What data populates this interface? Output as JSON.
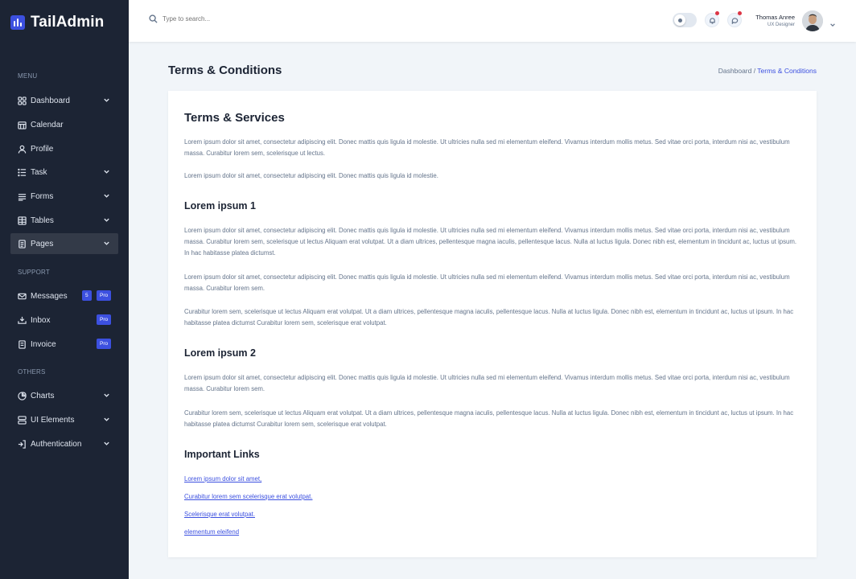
{
  "brand": {
    "name": "TailAdmin"
  },
  "sidebar": {
    "sections": {
      "menu": "MENU",
      "support": "SUPPORT",
      "others": "OTHERS"
    },
    "items": [
      {
        "label": "Dashboard",
        "icon": "grid-icon"
      },
      {
        "label": "Calendar",
        "icon": "calendar-icon"
      },
      {
        "label": "Profile",
        "icon": "user-icon"
      },
      {
        "label": "Task",
        "icon": "list-icon"
      },
      {
        "label": "Forms",
        "icon": "form-icon"
      },
      {
        "label": "Tables",
        "icon": "table-icon"
      },
      {
        "label": "Pages",
        "icon": "page-icon",
        "active": true
      },
      {
        "label": "Messages",
        "icon": "mail-icon",
        "count": "5",
        "badge": "Pro"
      },
      {
        "label": "Inbox",
        "icon": "inbox-icon",
        "badge": "Pro"
      },
      {
        "label": "Invoice",
        "icon": "invoice-icon",
        "badge": "Pro"
      },
      {
        "label": "Charts",
        "icon": "pie-chart-icon"
      },
      {
        "label": "UI Elements",
        "icon": "layers-icon"
      },
      {
        "label": "Authentication",
        "icon": "login-icon"
      }
    ]
  },
  "header": {
    "search_placeholder": "Type to search...",
    "user": {
      "name": "Thomas Anree",
      "role": "UX Designer"
    }
  },
  "page": {
    "title": "Terms & Conditions",
    "breadcrumb": {
      "parent": "Dashboard /",
      "current": "Terms & Conditions"
    }
  },
  "content": {
    "h_services": "Terms & Services",
    "p1": "Lorem ipsum dolor sit amet, consectetur adipiscing elit. Donec mattis quis ligula id molestie. Ut ultricies nulla sed mi elementum eleifend. Vivamus interdum mollis metus. Sed vitae orci porta, interdum nisi ac, vestibulum massa. Curabitur lorem sem, scelerisque ut lectus.",
    "p2": "Lorem ipsum dolor sit amet, consectetur adipiscing elit. Donec mattis quis ligula id molestie.",
    "h_lorem1": "Lorem ipsum 1",
    "p3": "Lorem ipsum dolor sit amet, consectetur adipiscing elit. Donec mattis quis ligula id molestie. Ut ultricies nulla sed mi elementum eleifend. Vivamus interdum mollis metus. Sed vitae orci porta, interdum nisi ac, vestibulum massa. Curabitur lorem sem, scelerisque ut lectus Aliquam erat volutpat. Ut a diam ultrices, pellentesque magna iaculis, pellentesque lacus. Nulla at luctus ligula. Donec nibh est, elementum in tincidunt ac, luctus ut ipsum. In hac habitasse platea dictumst.",
    "p4": "Lorem ipsum dolor sit amet, consectetur adipiscing elit. Donec mattis quis ligula id molestie. Ut ultricies nulla sed mi elementum eleifend. Vivamus interdum mollis metus. Sed vitae orci porta, interdum nisi ac, vestibulum massa. Curabitur lorem sem.",
    "p5": "Curabitur lorem sem, scelerisque ut lectus Aliquam erat volutpat. Ut a diam ultrices, pellentesque magna iaculis, pellentesque lacus. Nulla at luctus ligula. Donec nibh est, elementum in tincidunt ac, luctus ut ipsum. In hac habitasse platea dictumst Curabitur lorem sem, scelerisque erat volutpat.",
    "h_lorem2": "Lorem ipsum 2",
    "p6": "Lorem ipsum dolor sit amet, consectetur adipiscing elit. Donec mattis quis ligula id molestie. Ut ultricies nulla sed mi elementum eleifend. Vivamus interdum mollis metus. Sed vitae orci porta, interdum nisi ac, vestibulum massa. Curabitur lorem sem.",
    "p7": "Curabitur lorem sem, scelerisque ut lectus Aliquam erat volutpat. Ut a diam ultrices, pellentesque magna iaculis, pellentesque lacus. Nulla at luctus ligula. Donec nibh est, elementum in tincidunt ac, luctus ut ipsum. In hac habitasse platea dictumst Curabitur lorem sem, scelerisque erat volutpat.",
    "h_links": "Important Links",
    "links": [
      "Lorem ipsum dolor sit amet,",
      "Curabitur lorem sem scelerisque erat volutpat.",
      "Scelerisque erat volutpat.",
      "elementum eleifend"
    ]
  },
  "colors": {
    "sidebar_bg": "#1c2434",
    "accent": "#3c50e0",
    "page_bg": "#f1f5f9",
    "notification_dot": "#dc3545"
  }
}
